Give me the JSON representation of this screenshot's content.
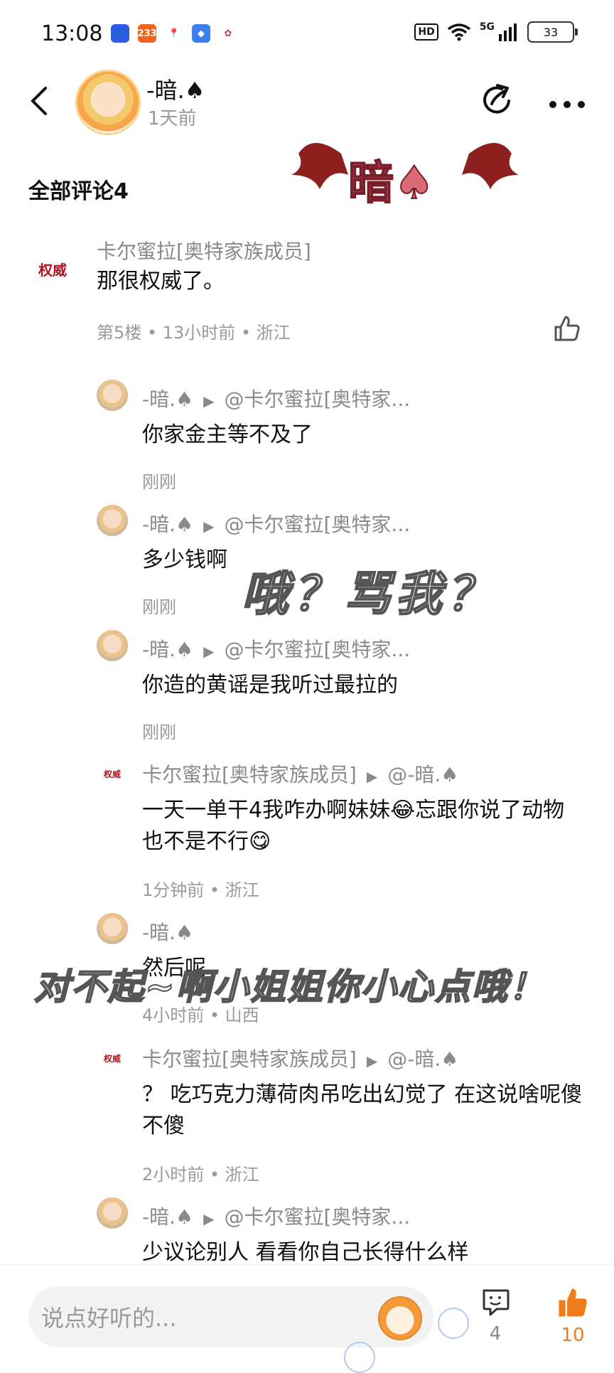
{
  "status_bar": {
    "time": "13:08",
    "hd": "HD",
    "network": "5G",
    "battery": "33"
  },
  "header": {
    "author_name": "-暗.♠",
    "author_time": "1天前"
  },
  "sticker_text": "暗♠",
  "section_title": "全部评论4",
  "comments": [
    {
      "name": "卡尔蜜拉[奥特家族成员]",
      "text": "那很权威了。",
      "meta": "第5楼 • 13小时前 • 浙江",
      "avatar_text": "权威"
    },
    {
      "name": "-暗.♠",
      "reply_to": "@卡尔蜜拉[奥特家...",
      "text": "你家金主等不及了",
      "meta": "刚刚"
    },
    {
      "name": "-暗.♠",
      "reply_to": "@卡尔蜜拉[奥特家...",
      "text": "多少钱啊",
      "meta": "刚刚"
    },
    {
      "name": "-暗.♠",
      "reply_to": "@卡尔蜜拉[奥特家...",
      "text": "你造的黄谣是我听过最拉的",
      "meta": "刚刚"
    },
    {
      "name": "卡尔蜜拉[奥特家族成员]",
      "reply_to": "@-暗.♠",
      "text": "一天一单干4我咋办啊妹妹😂忘跟你说了动物也不是不行😋",
      "meta": "1分钟前 • 浙江",
      "avatar_text": "权威"
    },
    {
      "name": "-暗.♠",
      "text": "然后呢",
      "meta": "4小时前 • 山西"
    },
    {
      "name": "卡尔蜜拉[奥特家族成员]",
      "reply_to": "@-暗.♠",
      "text": "？ 吃巧克力薄荷肉吊吃出幻觉了  在这说啥呢傻不傻",
      "meta": "2小时前 • 浙江",
      "avatar_text": "权威"
    },
    {
      "name": "-暗.♠",
      "reply_to": "@卡尔蜜拉[奥特家...",
      "text": "少议论别人 看看你自己长得什么样",
      "meta": ""
    }
  ],
  "overlays": {
    "text1": "哦？骂我？",
    "text2": "对不起~啊小姐姐你小心点哦！"
  },
  "bottom_bar": {
    "input_placeholder": "说点好听的...",
    "comment_count": "4",
    "like_count": "10"
  },
  "colors": {
    "accent": "#f07b1d",
    "muted": "#8a8a8a"
  }
}
